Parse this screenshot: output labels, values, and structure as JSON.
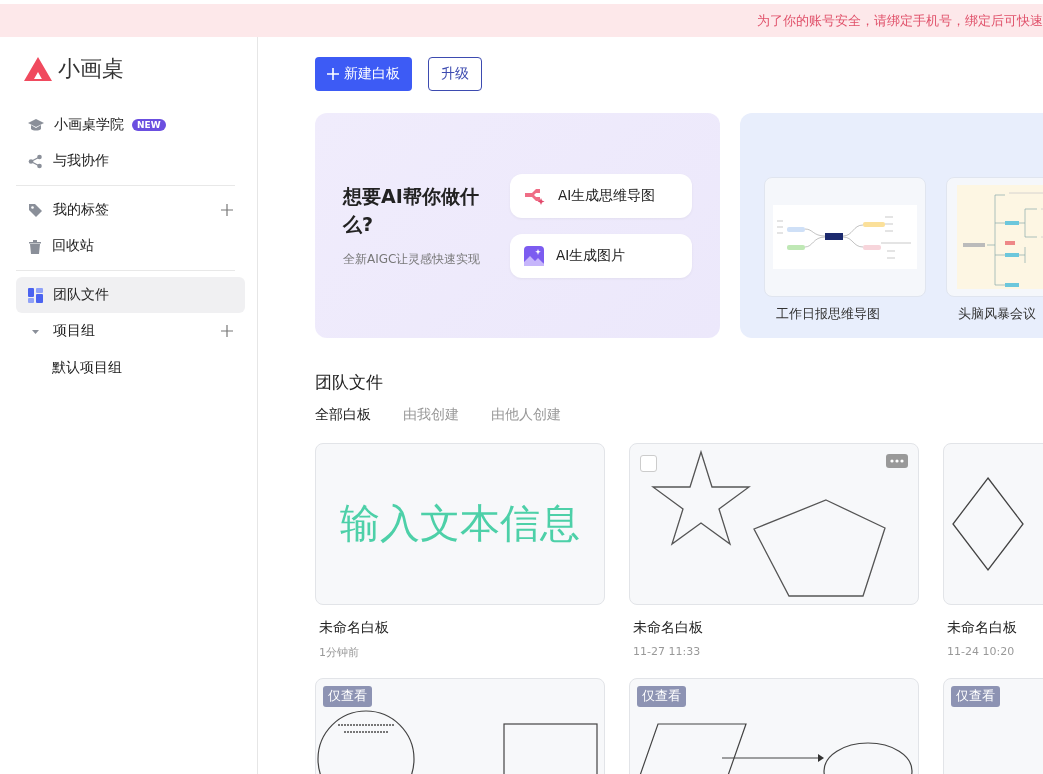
{
  "notice": {
    "text": "为了你的账号安全，请绑定手机号，绑定后可快速"
  },
  "sidebar": {
    "logo": "小画桌",
    "groups": [
      [
        {
          "kind": "academy",
          "label": "小画桌学院",
          "badge": "NEW",
          "selected": false
        },
        {
          "kind": "share",
          "label": "与我协作",
          "selected": false
        }
      ],
      [
        {
          "kind": "tag",
          "label": "我的标签",
          "add": true,
          "selected": false
        },
        {
          "kind": "trash",
          "label": "回收站",
          "selected": false
        }
      ],
      [
        {
          "kind": "team",
          "label": "团队文件",
          "selected": true
        },
        {
          "kind": "folder",
          "label": "项目组",
          "add": true,
          "expanded": true,
          "selected": false,
          "children": [
            {
              "label": "默认项目组",
              "selected": false
            }
          ]
        }
      ]
    ]
  },
  "toolbar": {
    "new_button": "新建白板",
    "upgrade_button": "升级"
  },
  "ai_card": {
    "title": "想要AI帮你做什么?",
    "subtitle": "全新AIGC让灵感快速实现",
    "actions": [
      {
        "kind": "mindmap",
        "label": "AI生成思维导图"
      },
      {
        "kind": "image",
        "label": "AI生成图片"
      }
    ]
  },
  "templates": [
    {
      "kind": "mindmap",
      "label": "工作日报思维导图"
    },
    {
      "kind": "tree",
      "label": "头脑风暴会议"
    }
  ],
  "section_title": "团队文件",
  "filters": [
    {
      "label": "全部白板",
      "selected": true
    },
    {
      "label": "由我创建",
      "selected": false
    },
    {
      "label": "由他人创建",
      "selected": false
    }
  ],
  "boards": [
    {
      "kind": "text",
      "preview_text": "输入文本信息",
      "title": "未命名白板",
      "time": "1分钟前",
      "hovered": false
    },
    {
      "kind": "star-pentagon",
      "title": "未命名白板",
      "time": "11-27 11:33",
      "hovered": true
    },
    {
      "kind": "diamond",
      "title": "未命名白板",
      "time": "11-24 10:20",
      "hovered": false
    },
    {
      "kind": "circle-rect",
      "badge": "仅查看"
    },
    {
      "kind": "flow",
      "badge": "仅查看"
    },
    {
      "kind": "blank",
      "badge": "仅查看"
    }
  ]
}
